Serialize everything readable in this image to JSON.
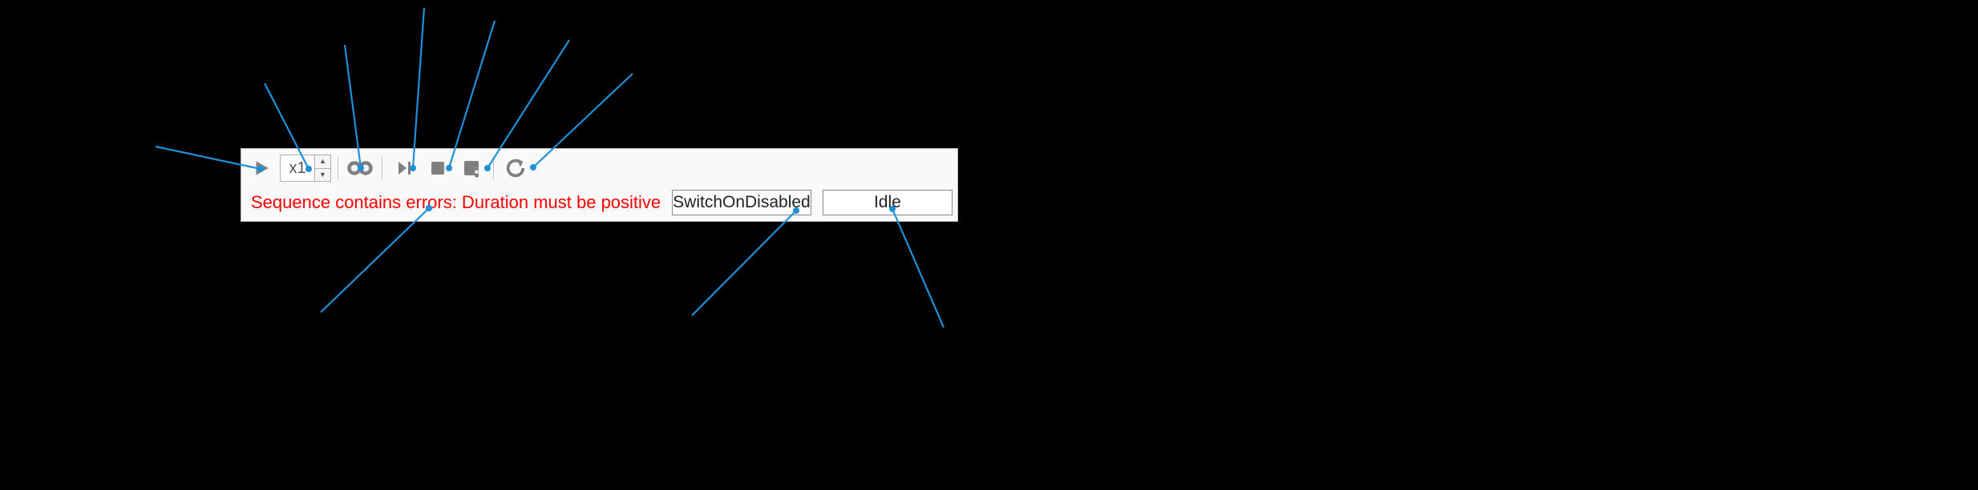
{
  "toolbar": {
    "play_icon": "play",
    "speed_value": "x1",
    "loop_icon": "loop",
    "step_icon": "step",
    "stop_icon": "stop",
    "estop_icon": "estop",
    "reset_icon": "reset"
  },
  "status": {
    "error_message": "Sequence contains errors: Duration must be positive",
    "state_mode": "SwitchOnDisabled",
    "state_runtime": "Idle"
  }
}
